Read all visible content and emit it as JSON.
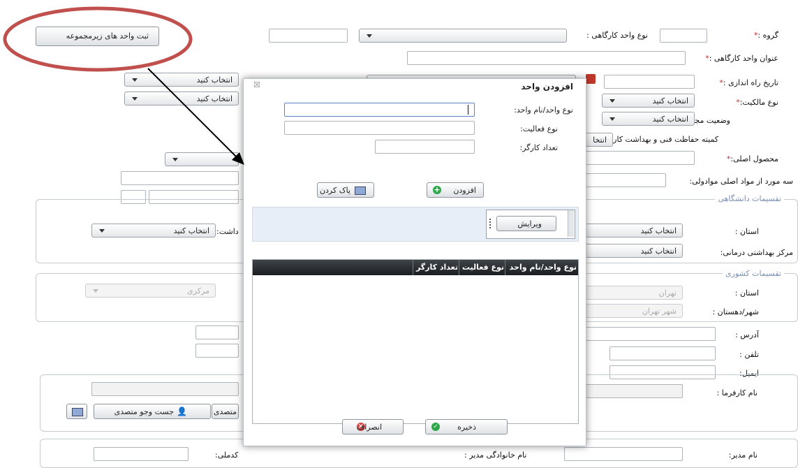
{
  "top_button_label": "ثبت واحد های زیرمجموعه",
  "form": {
    "group_label": "گروه :",
    "unit_type_label": "نوع واحد کارگاهی :",
    "unit_title_label": "عنوان واحد کارگاهی :",
    "launch_date_label": "تاریخ راه اندازی :",
    "ownership_label": "نوع مالکیت:",
    "license_status_label": "وضعیت مجوز:",
    "committee_label": "کمیته حفاظت فنی و بهداشت کار:",
    "main_product_label": "محصول اصلی:",
    "raw_material_label": "سه مورد از مواد اصلی موادولی:",
    "select_placeholder": "انتخاب کنید",
    "select_short": "انتخا",
    "uni_division_legend": "تقسیمات دانشگاهی",
    "province_label": "استان :",
    "health_center_label": "مرکز بهداشتی درمانی:",
    "health_partial_label": "داشت:",
    "country_division_legend": "تقسیمات کشوری",
    "province_value": "تهران",
    "city_label": "شهر/دهستان :",
    "city_value": "شهر تهران",
    "central_value": "مرکزی",
    "address_label": "آدرس :",
    "phone_label": "تلفن :",
    "email_label": "ایمیل:",
    "employer_label": "نام کارفرما :",
    "search_official_label": "جست وجو متصدی",
    "official_partial": "متصدی",
    "manager_label": "نام مدیر:",
    "manager_family_label": "نام خانوادگی مدیر :",
    "national_code_label": "کدملی:"
  },
  "dialog": {
    "title": "افزودن واحد",
    "close_symbol": "☒",
    "unit_type_name_label": "نوع واحد/نام واحد:",
    "activity_type_label": "نوع فعالیت:",
    "worker_count_label": "تعداد کارگر:",
    "add_button": "افزودن",
    "clear_button": "پاک کردن",
    "edit_button": "ویرایش",
    "grid_columns": [
      "نوع واحد/نام واحد",
      "نوع فعالیت",
      "تعداد کارگر"
    ],
    "save_button": "ذخیره",
    "cancel_button": "انصراف"
  },
  "colors": {
    "annotation_ellipse": "#c0504d",
    "required_star": "#c03030",
    "legend_text": "#7a8fb0",
    "grid_header": "#1b1d20"
  }
}
